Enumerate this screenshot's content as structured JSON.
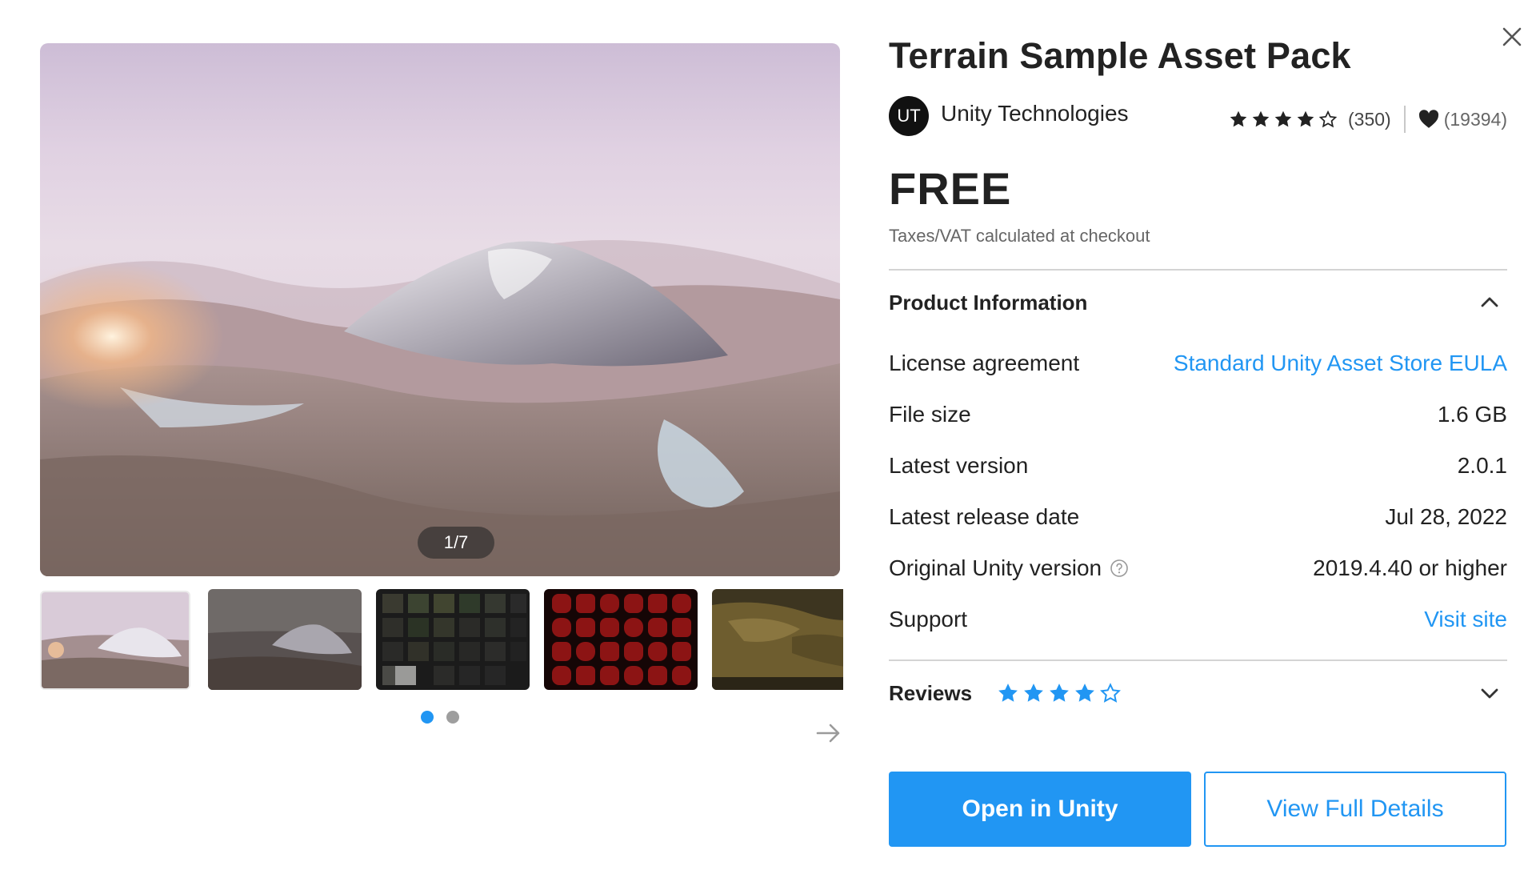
{
  "gallery": {
    "counter": "1/7",
    "thumbnails": [
      "terrain-overview",
      "terrain-dusk",
      "material-swatches-dark",
      "red-brush-grid",
      "terrain-olive"
    ],
    "page_dots": 2,
    "active_dot": 0
  },
  "product": {
    "title": "Terrain Sample Asset Pack",
    "publisher_initials": "UT",
    "publisher": "Unity Technologies",
    "rating_stars": 4,
    "rating_count": "(350)",
    "favorites": "(19394)",
    "price": "FREE",
    "tax_note": "Taxes/VAT calculated at checkout"
  },
  "product_info": {
    "title": "Product Information",
    "rows": [
      {
        "label": "License agreement",
        "value": "Standard Unity Asset Store EULA"
      },
      {
        "label": "File size",
        "value": "1.6 GB"
      },
      {
        "label": "Latest version",
        "value": "2.0.1"
      },
      {
        "label": "Latest release date",
        "value": "Jul 28, 2022"
      },
      {
        "label": "Original Unity version",
        "value": "2019.4.40 or higher"
      },
      {
        "label": "Support",
        "value": "Visit site"
      }
    ]
  },
  "reviews": {
    "title": "Reviews",
    "stars": 4
  },
  "actions": {
    "primary": "Open in Unity",
    "secondary": "View Full Details"
  },
  "colors": {
    "accent": "#2196f3",
    "text": "#222222",
    "muted": "#666666"
  }
}
